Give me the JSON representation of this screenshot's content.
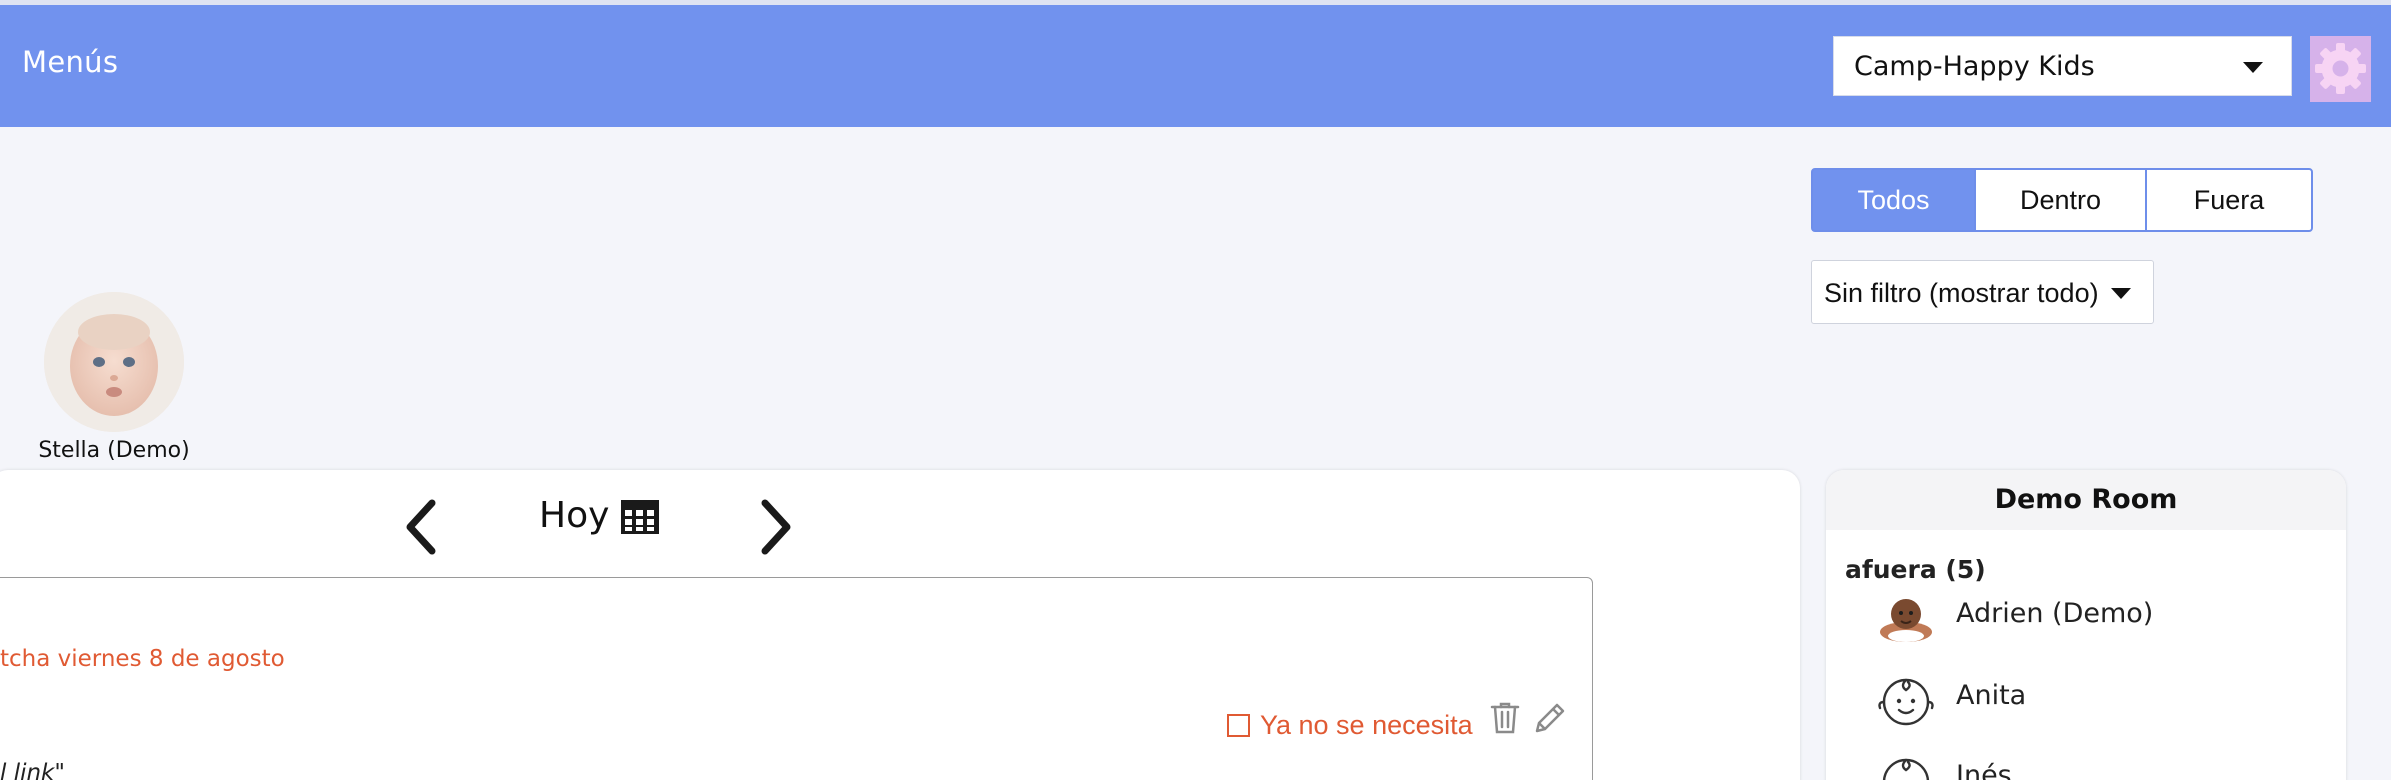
{
  "header": {
    "title": "Menús",
    "camp_select": "Camp-Happy Kids",
    "brand_color": "#7192ee"
  },
  "view_toggle": {
    "options": [
      "Todos",
      "Dentro",
      "Fuera"
    ],
    "selected": "Todos"
  },
  "filter": {
    "selected": "Sin filtro (mostrar todo)"
  },
  "child": {
    "name": "Stella (Demo)"
  },
  "date_nav": {
    "label": "Hoy"
  },
  "entry": {
    "date_text": "tcha viernes 8 de agosto",
    "snippet": "l link\"",
    "no_longer_needed": "Ya no se necesita",
    "accent_color": "#e05a33"
  },
  "room": {
    "title": "Demo Room",
    "group_label": "afuera (5)",
    "children": [
      "Adrien (Demo)",
      "Anita",
      "Inés"
    ]
  },
  "icons": [
    "gear-icon",
    "chevron-left-icon",
    "chevron-right-icon",
    "calendar-icon",
    "trash-icon",
    "pencil-icon",
    "baby-face-icon",
    "caret-down-icon"
  ]
}
